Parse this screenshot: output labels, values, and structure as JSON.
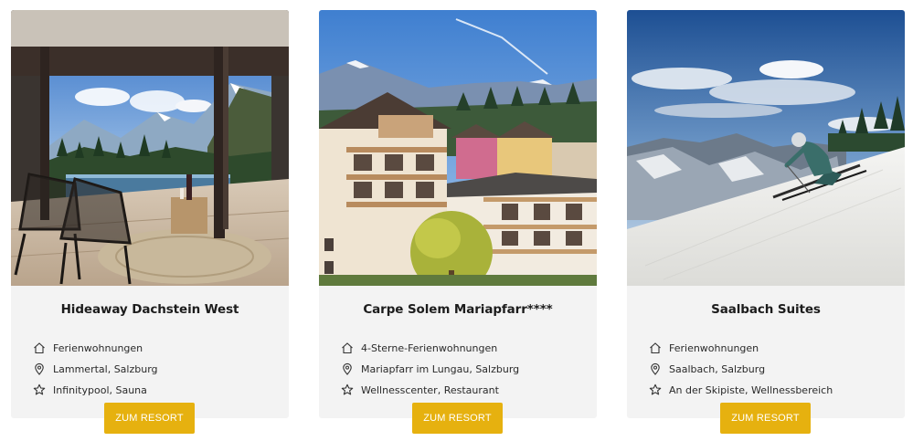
{
  "cards": [
    {
      "title": "Hideaway Dachstein West",
      "features": [
        {
          "icon": "house-icon",
          "text": "Ferienwohnungen"
        },
        {
          "icon": "location-pin-icon",
          "text": "Lammertal, Salzburg"
        },
        {
          "icon": "star-icon",
          "text": "Infinitypool, Sauna"
        }
      ],
      "button": "ZUM RESORT",
      "image": "hotel-terrace-infinity-pool-photo"
    },
    {
      "title": "Carpe Solem Mariapfarr****",
      "features": [
        {
          "icon": "house-icon",
          "text": "4-Sterne-Ferienwohnungen"
        },
        {
          "icon": "location-pin-icon",
          "text": "Mariapfarr im Lungau, Salzburg"
        },
        {
          "icon": "star-icon",
          "text": "Wellnesscenter, Restaurant"
        }
      ],
      "button": "ZUM RESORT",
      "image": "alpine-apartment-building-photo"
    },
    {
      "title": "Saalbach Suites",
      "features": [
        {
          "icon": "house-icon",
          "text": "Ferienwohnungen"
        },
        {
          "icon": "location-pin-icon",
          "text": "Saalbach, Salzburg"
        },
        {
          "icon": "star-icon",
          "text": "An der Skipiste, Wellnessbereich"
        }
      ],
      "button": "ZUM RESORT",
      "image": "skier-on-slope-photo"
    }
  ],
  "colors": {
    "button_bg": "#e6b10f",
    "card_bg": "#f3f3f3",
    "button_text": "#ffffff"
  }
}
